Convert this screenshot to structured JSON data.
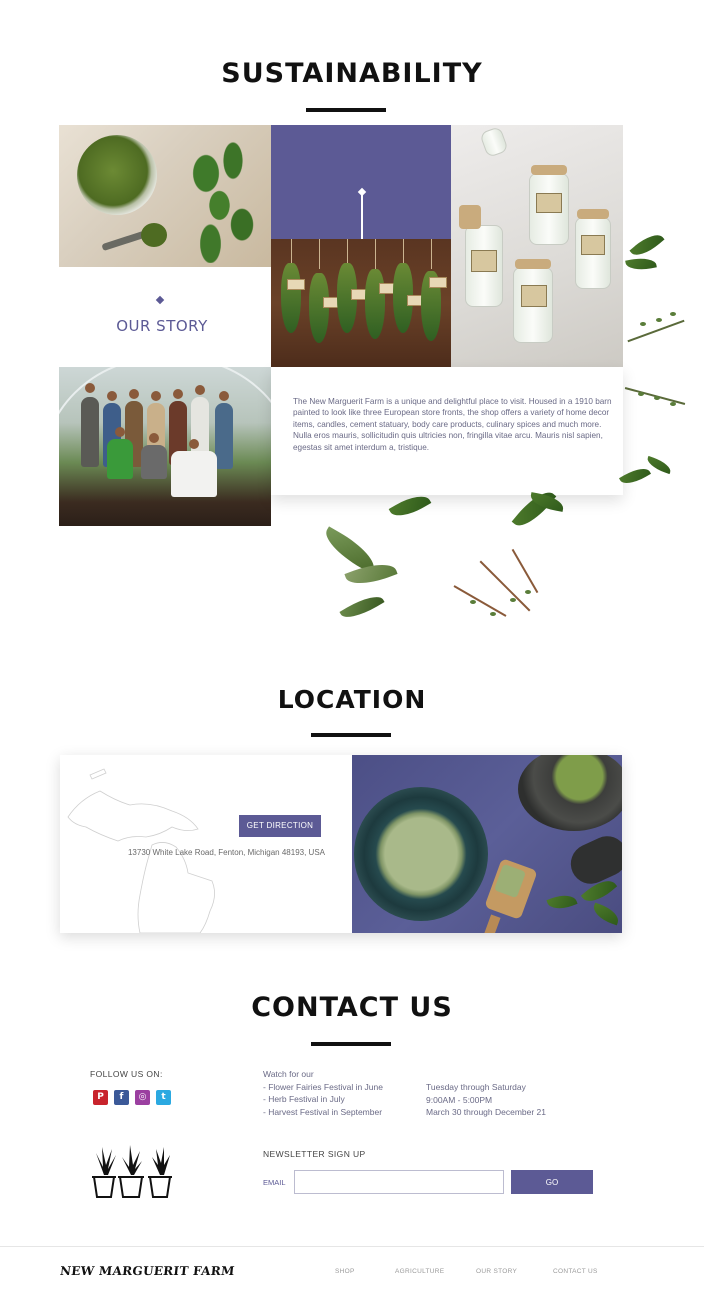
{
  "sustainability": {
    "title": "SUSTAINABILITY",
    "our_story_label": "OUR STORY",
    "description": "The New Marguerit Farm is a unique and delightful place to visit. Housed in a 1910 barn painted to look like three European store fronts, the shop offers a variety of home decor items, candles, cement statuary, body care products, culinary spices and much more. Nulla eros mauris, sollicitudin quis ultricies non, fringilla vitae arcu. Mauris nisl sapien, egestas sit amet interdum a, tristique."
  },
  "location": {
    "title": "LOCATION",
    "button_label": "GET DIRECTION",
    "address": "13730 White Lake Road, Fenton, Michigan 48193, USA"
  },
  "contact": {
    "title": "CONTACT US",
    "follow_label": "FOLLOW US ON:",
    "social": [
      {
        "icon": "pinterest-icon",
        "glyph": "P",
        "color": "#c8232c"
      },
      {
        "icon": "facebook-icon",
        "glyph": "f",
        "color": "#3b5998"
      },
      {
        "icon": "instagram-icon",
        "glyph": "◎",
        "color": "#9b3fa0"
      },
      {
        "icon": "twitter-icon",
        "glyph": "t",
        "color": "#2ba9e1"
      }
    ],
    "events": {
      "intro": "Watch for our",
      "items": [
        "- Flower Fairies Festival in June",
        "- Herb Festival in July",
        "- Harvest Festival in September"
      ]
    },
    "hours": [
      "Tuesday through Saturday",
      "9:00AM - 5:00PM",
      "March 30 through December 21"
    ],
    "newsletter": {
      "label": "NEWSLETTER SIGN UP",
      "email_label": "EMAIL",
      "email_value": "",
      "button_label": "GO"
    }
  },
  "footer": {
    "logo": "NEW MARGUERIT FARM",
    "nav": [
      "SHOP",
      "AGRICULTURE",
      "OUR STORY",
      "CONTACT US"
    ]
  },
  "colors": {
    "accent": "#5c5a95",
    "text_muted": "#6a6a86",
    "heading": "#111111"
  }
}
